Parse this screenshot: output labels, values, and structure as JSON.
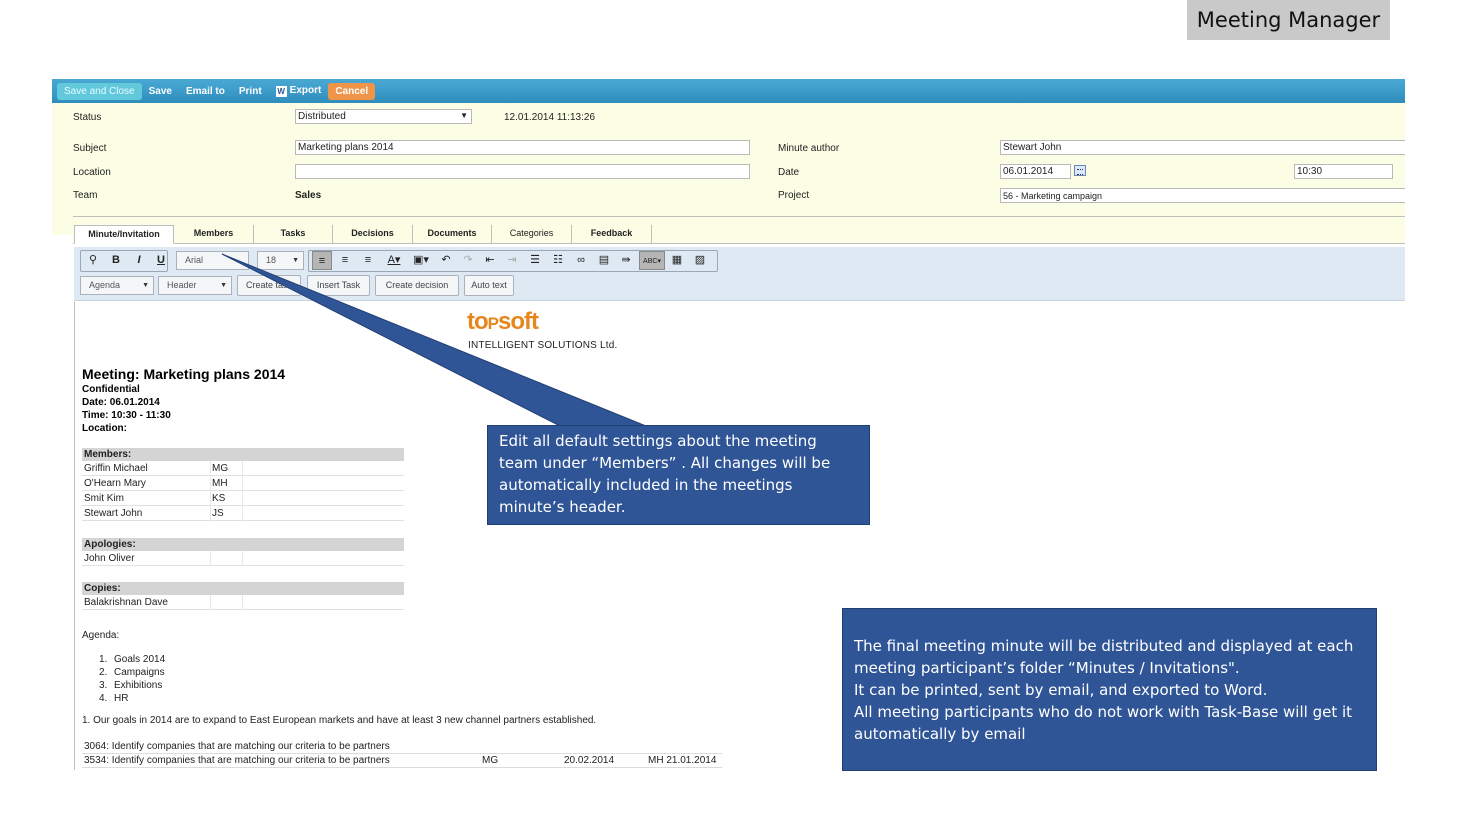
{
  "page_title": "Meeting Manager",
  "toolbar": {
    "save_close": "Save and Close",
    "save": "Save",
    "email_to": "Email to",
    "print": "Print",
    "word_icon_letter": "W",
    "export": "Export",
    "cancel": "Cancel"
  },
  "form": {
    "status_label": "Status",
    "status_value": "Distributed",
    "status_timestamp": "12.01.2014 11:13:26",
    "subject_label": "Subject",
    "subject_value": "Marketing plans 2014",
    "location_label": "Location",
    "location_value": "",
    "team_label": "Team",
    "team_value": "Sales",
    "author_label": "Minute author",
    "author_value": "Stewart John",
    "date_label": "Date",
    "date_value": "06.01.2014",
    "time_value": "10:30",
    "project_label": "Project",
    "project_value": "56 - Marketing campaign"
  },
  "tabs": [
    "Minute/Invitation",
    "Members",
    "Tasks",
    "Decisions",
    "Documents",
    "Categories",
    "Feedback"
  ],
  "editor": {
    "font": "Arial",
    "size": "18",
    "agenda_dropdown": "Agenda",
    "header_dropdown": "Header",
    "create_task": "Create task",
    "insert_task": "Insert Task",
    "create_decision": "Create decision",
    "auto_text": "Auto text",
    "spell_label": "ABC"
  },
  "document": {
    "logo_to": "to",
    "logo_p": "P",
    "logo_soft": "soft",
    "logo_sub": "INTELLIGENT SOLUTIONS Ltd.",
    "title": "Meeting: Marketing plans 2014",
    "confidential": "Confidential",
    "date": "Date: 06.01.2014",
    "time": "Time: 10:30 - 11:30",
    "location": "Location:",
    "members_head": "Members:",
    "members": [
      {
        "name": "Griffin Michael",
        "initials": "MG"
      },
      {
        "name": "O'Hearn Mary",
        "initials": "MH"
      },
      {
        "name": "Smit Kim",
        "initials": "KS"
      },
      {
        "name": "Stewart John",
        "initials": "JS"
      }
    ],
    "apologies_head": "Apologies:",
    "apologies": [
      "John Oliver"
    ],
    "copies_head": "Copies:",
    "copies": [
      "Balakrishnan Dave"
    ],
    "agenda_label": "Agenda:",
    "agenda": [
      {
        "num": "1.",
        "text": "Goals 2014"
      },
      {
        "num": "2.",
        "text": "Campaigns"
      },
      {
        "num": "3.",
        "text": "Exhibitions"
      },
      {
        "num": "4.",
        "text": "HR"
      }
    ],
    "goals_text": "1.  Our goals in 2014 are to expand to East European markets and have at least 3 new channel partners established.",
    "tasks": [
      {
        "text": "3064: Identify companies that are matching our criteria to be partners",
        "owner": "",
        "due": "",
        "resp": ""
      },
      {
        "text": "3534: Identify companies that are matching our criteria to be partners",
        "owner": "MG",
        "due": "20.02.2014",
        "resp": "MH 21.01.2014"
      }
    ]
  },
  "callouts": {
    "members_note": "Edit all default settings about the meeting team under “Members” . All changes will be automatically included in the meetings minute’s header.",
    "final_line1": "The final meeting minute will be distributed and displayed at each meeting participant’s  folder “Minutes / Invitations\".",
    "final_line2": "It can be printed, sent by email, and exported to Word.",
    "final_line3": "All meeting participants who do not work with Task-Base will  get it automatically by email"
  },
  "colors": {
    "topbar": "#2f8dbd",
    "form_bg": "#fbfde4",
    "callout": "#2f5597",
    "logo": "#e6871e",
    "cancel": "#f0944a"
  }
}
